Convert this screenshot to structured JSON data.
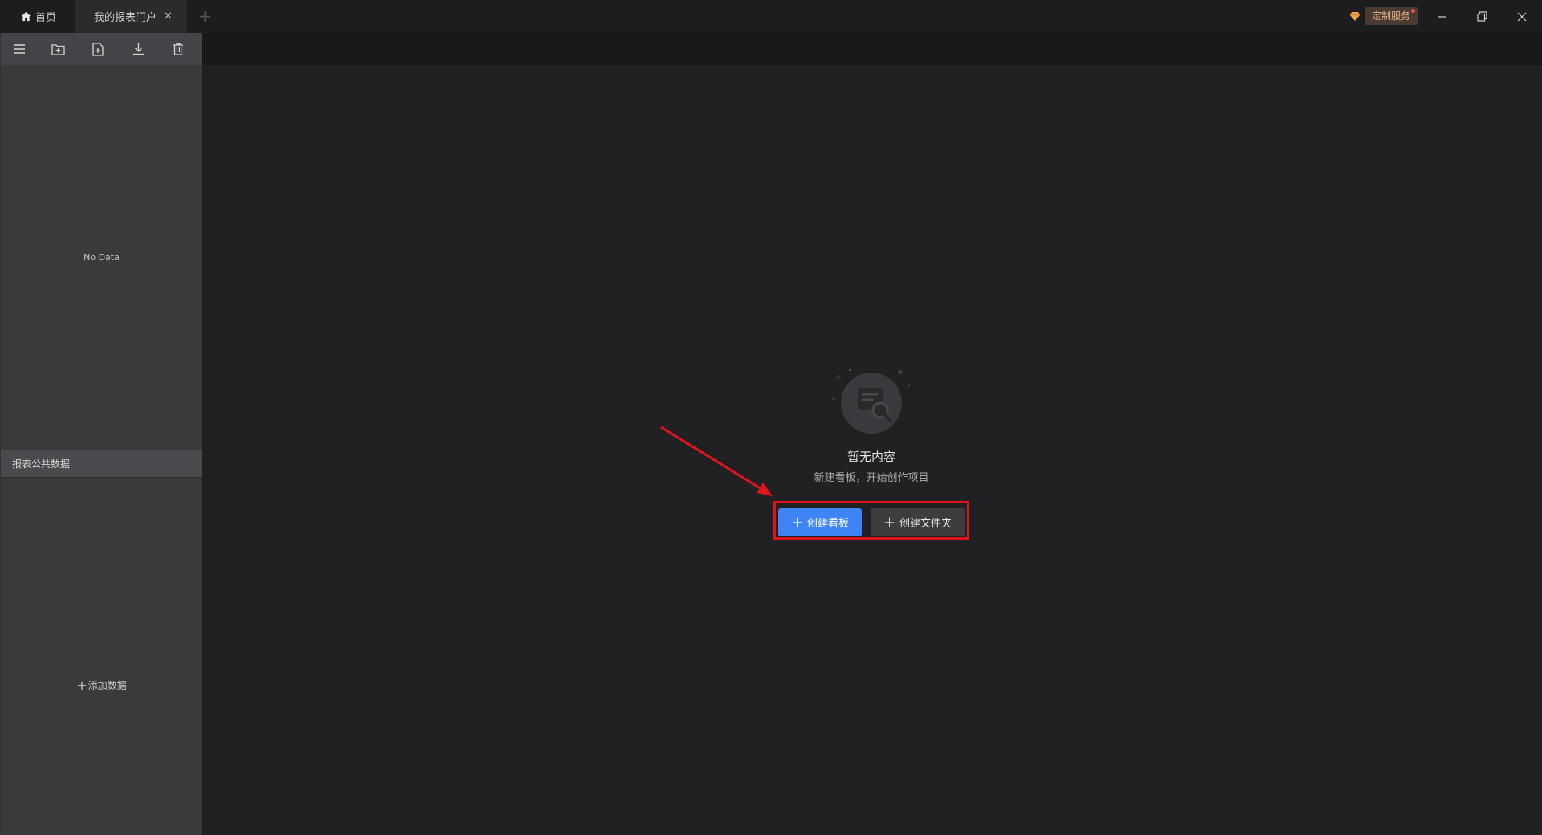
{
  "tabs": {
    "home_label": "首页",
    "active_label": "我的报表门户",
    "close_glyph": "✕",
    "add_glyph": "+"
  },
  "header": {
    "custom_service_label": "定制服务"
  },
  "sidebar": {
    "tools": [
      "menu-icon",
      "folder-add-icon",
      "file-add-icon",
      "download-icon",
      "delete-icon"
    ],
    "no_data_text": "No Data",
    "section_title": "报表公共数据",
    "add_data_label": "添加数据",
    "plus_glyph": "+"
  },
  "main": {
    "empty_title": "暂无内容",
    "empty_subtitle": "新建看板，开始创作项目",
    "create_board_label": "创建看板",
    "create_folder_label": "创建文件夹",
    "plus_glyph": "+"
  },
  "colors": {
    "primary": "#3f84f7",
    "annotation": "#e0141b",
    "service_text": "#e8b08a"
  }
}
